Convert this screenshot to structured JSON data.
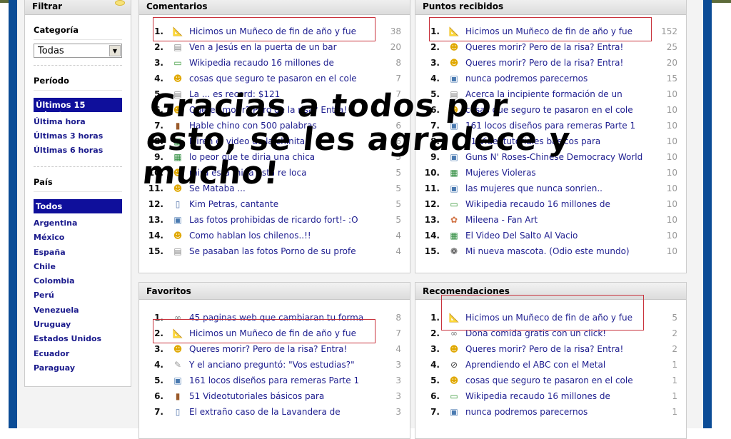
{
  "sidebar": {
    "title": "Filtrar",
    "categoria_label": "Categoría",
    "categoria_value": "Todas",
    "periodo_label": "Período",
    "periodo_items": [
      "Últimos 15 minutos",
      "Última hora",
      "Últimas 3 horas",
      "Últimas 6 horas"
    ],
    "periodo_selected": 0,
    "pais_label": "País",
    "pais_items": [
      "Todos",
      "Argentina",
      "México",
      "España",
      "Chile",
      "Colombia",
      "Perú",
      "Venezuela",
      "Uruguay",
      "Estados Unidos",
      "Ecuador",
      "Paraguay"
    ],
    "pais_selected": 0
  },
  "panels": [
    {
      "title": "Comentarios",
      "highlight_row": 0,
      "rows": [
        {
          "n": "1.",
          "icon": "ruler-icon",
          "t": "Hicimos un Muñeco de fin de año y fue",
          "c": "38"
        },
        {
          "n": "2.",
          "icon": "document-icon",
          "t": "Ven a Jesús en la puerta de un bar",
          "c": "20"
        },
        {
          "n": "3.",
          "icon": "money-icon",
          "t": "Wikipedia recaudo 16 millones de",
          "c": "8"
        },
        {
          "n": "4.",
          "icon": "smiley-icon",
          "t": "cosas que seguro te pasaron en el cole",
          "c": "7"
        },
        {
          "n": "5.",
          "icon": "document-icon",
          "t": "La ... es record: $121",
          "c": "7"
        },
        {
          "n": "6.",
          "icon": "smiley-icon",
          "t": "Queres morir? Pero de la risa? Entra!",
          "c": "7"
        },
        {
          "n": "7.",
          "icon": "book-icon",
          "t": "Hable chino con 500 palabras",
          "c": "6"
        },
        {
          "n": "8.",
          "icon": "film-icon",
          "t": "Miren el video de la chinita",
          "c": "6"
        },
        {
          "n": "9.",
          "icon": "film-icon",
          "t": "lo peor que te diria una chica",
          "c": "5"
        },
        {
          "n": "10.",
          "icon": "smiley-icon",
          "t": "mira esta mina esta re loca",
          "c": "5"
        },
        {
          "n": "11.",
          "icon": "smiley-icon",
          "t": "Se Mataba ...",
          "c": "5"
        },
        {
          "n": "12.",
          "icon": "open-book-icon",
          "t": "Kim Petras, cantante",
          "c": "5"
        },
        {
          "n": "13.",
          "icon": "image-icon",
          "t": "Las fotos prohibidas de ricardo fort!- :O",
          "c": "5"
        },
        {
          "n": "14.",
          "icon": "smiley-icon",
          "t": "Como hablan los chilenos..!!",
          "c": "4"
        },
        {
          "n": "15.",
          "icon": "document-icon",
          "t": "Se pasaban las fotos Porno de su profe",
          "c": "4"
        }
      ]
    },
    {
      "title": "Puntos recibidos",
      "highlight_row": 0,
      "rows": [
        {
          "n": "1.",
          "icon": "ruler-icon",
          "t": "Hicimos un Muñeco de fin de año y fue",
          "c": "152"
        },
        {
          "n": "2.",
          "icon": "smiley-icon",
          "t": "Queres morir? Pero de la risa? Entra!",
          "c": "25"
        },
        {
          "n": "3.",
          "icon": "smiley-icon",
          "t": "Queres morir? Pero de la risa? Entra!",
          "c": "20"
        },
        {
          "n": "4.",
          "icon": "image-icon",
          "t": "nunca podremos parecernos",
          "c": "15"
        },
        {
          "n": "5.",
          "icon": "document-icon",
          "t": "Acerca la incipiente formación de un",
          "c": "10"
        },
        {
          "n": "6.",
          "icon": "smiley-icon",
          "t": "cosas que seguro te pasaron en el cole",
          "c": "10"
        },
        {
          "n": "7.",
          "icon": "image-icon",
          "t": "161 locos diseños para remeras Parte 1",
          "c": "10"
        },
        {
          "n": "8.",
          "icon": "book-icon",
          "t": "51 Videotutoriales básicos para",
          "c": "10"
        },
        {
          "n": "9.",
          "icon": "image-icon",
          "t": "Guns N' Roses-Chinese Democracy World",
          "c": "10"
        },
        {
          "n": "10.",
          "icon": "film-icon",
          "t": "Mujeres Violeras",
          "c": "10"
        },
        {
          "n": "11.",
          "icon": "image-icon",
          "t": "las mujeres que nunca sonrien..",
          "c": "10"
        },
        {
          "n": "12.",
          "icon": "money-icon",
          "t": "Wikipedia recaudo 16 millones de",
          "c": "10"
        },
        {
          "n": "13.",
          "icon": "palette-icon",
          "t": "Mileena - Fan Art",
          "c": "10"
        },
        {
          "n": "14.",
          "icon": "film-icon",
          "t": "El Video Del Salto Al Vacio",
          "c": "10"
        },
        {
          "n": "15.",
          "icon": "paw-icon",
          "t": "Mi nueva mascota. (Odio este mundo)",
          "c": "10"
        }
      ]
    },
    {
      "title": "Favoritos",
      "highlight_row": 1,
      "rows": [
        {
          "n": "1.",
          "icon": "link-icon",
          "t": "45 paginas web que cambiaran tu forma",
          "c": "8"
        },
        {
          "n": "2.",
          "icon": "ruler-icon",
          "t": "Hicimos un Muñeco de fin de año y fue",
          "c": "7"
        },
        {
          "n": "3.",
          "icon": "smiley-icon",
          "t": "Queres morir? Pero de la risa? Entra!",
          "c": "4"
        },
        {
          "n": "4.",
          "icon": "speech-icon",
          "t": "Y el anciano preguntó: \"Vos estudias?\"",
          "c": "3"
        },
        {
          "n": "5.",
          "icon": "image-icon",
          "t": "161 locos diseños para remeras Parte 1",
          "c": "3"
        },
        {
          "n": "6.",
          "icon": "book-icon",
          "t": "51 Videotutoriales básicos para",
          "c": "3"
        },
        {
          "n": "7.",
          "icon": "open-book-icon",
          "t": "El extraño caso de la Lavandera de",
          "c": "3"
        }
      ]
    },
    {
      "title": "Recomendaciones",
      "highlight_row": 0,
      "rows": [
        {
          "n": "1.",
          "icon": "ruler-icon",
          "t": "Hicimos un Muñeco de fin de año y fue",
          "c": "5"
        },
        {
          "n": "2.",
          "icon": "link-icon",
          "t": "Dona comida gratis con un click!",
          "c": "2"
        },
        {
          "n": "3.",
          "icon": "smiley-icon",
          "t": "Queres morir? Pero de la risa? Entra!",
          "c": "2"
        },
        {
          "n": "4.",
          "icon": "compass-icon",
          "t": "Aprendiendo el ABC con el Metal",
          "c": "1"
        },
        {
          "n": "5.",
          "icon": "smiley-icon",
          "t": "cosas que seguro te pasaron en el cole",
          "c": "1"
        },
        {
          "n": "6.",
          "icon": "money-icon",
          "t": "Wikipedia recaudo 16 millones de",
          "c": "1"
        },
        {
          "n": "7.",
          "icon": "image-icon",
          "t": "nunca podremos parecernos",
          "c": "1"
        }
      ]
    }
  ],
  "overlay": {
    "lines": [
      "Gracias a todos por",
      "esto, se les agradece y",
      "mucho!"
    ]
  }
}
